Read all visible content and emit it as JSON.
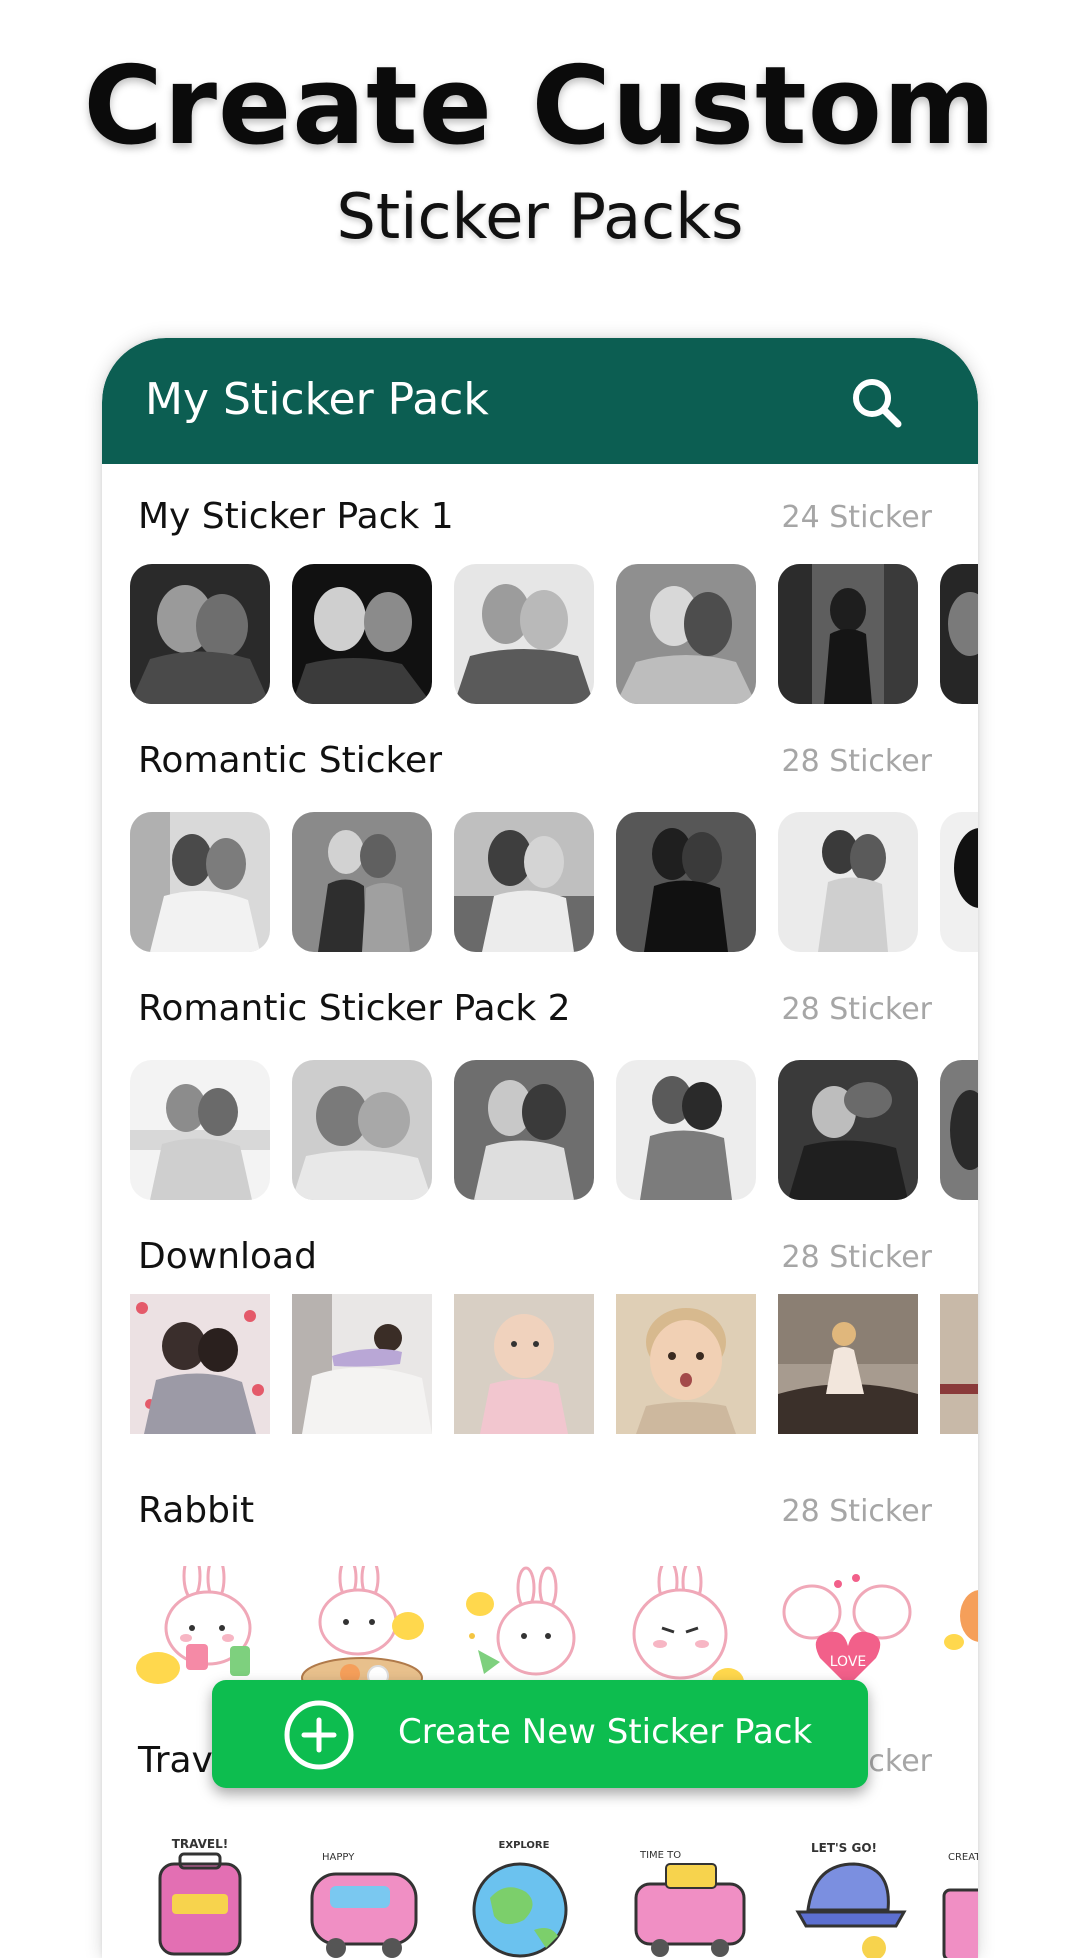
{
  "hero": {
    "title": "Create Custom",
    "subtitle": "Sticker Packs"
  },
  "appbar": {
    "title": "My Sticker Pack",
    "search_icon": "search-icon"
  },
  "packs": [
    {
      "name": "My Sticker Pack 1",
      "count": "24 Sticker",
      "style": "photo-bw"
    },
    {
      "name": "Romantic Sticker",
      "count": "28 Sticker",
      "style": "photo-bw"
    },
    {
      "name": "Romantic Sticker Pack 2",
      "count": "28 Sticker",
      "style": "photo-bw"
    },
    {
      "name": "Download",
      "count": "28 Sticker",
      "style": "photo-color"
    },
    {
      "name": "Rabbit",
      "count": "28 Sticker",
      "style": "cartoon-rabbit"
    },
    {
      "name": "Trav",
      "count": "cker",
      "style": "cartoon-travel"
    }
  ],
  "fab": {
    "label": "Create New Sticker Pack",
    "icon": "add-circle-icon"
  },
  "colors": {
    "appbar": "#0c5e52",
    "fab": "#0dbd4f",
    "count": "#a6a6a6"
  }
}
